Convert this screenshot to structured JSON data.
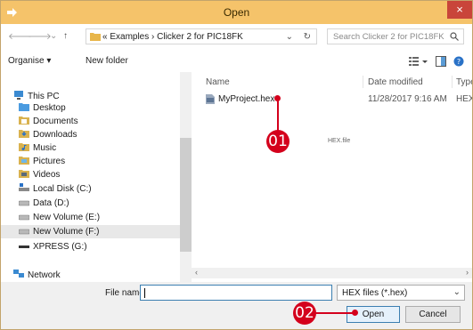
{
  "window": {
    "title": "Open",
    "close_glyph": "×"
  },
  "nav": {
    "back": "🡐",
    "forward": "🡒",
    "dropdown": "⌄",
    "up": "↑"
  },
  "address": {
    "crumbs": "«  Examples  ›  Clicker 2 for PIC18FK",
    "chevron": "⌄",
    "refresh": "↻"
  },
  "search": {
    "placeholder": "Search Clicker 2 for PIC18FK"
  },
  "toolbar": {
    "organise": "Organise ▾",
    "new_folder": "New folder"
  },
  "sidebar": {
    "items": [
      {
        "label": "This PC",
        "icon": "pc-icon"
      },
      {
        "label": "Desktop",
        "icon": "desktop-icon"
      },
      {
        "label": "Documents",
        "icon": "documents-icon"
      },
      {
        "label": "Downloads",
        "icon": "downloads-icon"
      },
      {
        "label": "Music",
        "icon": "music-icon"
      },
      {
        "label": "Pictures",
        "icon": "pictures-icon"
      },
      {
        "label": "Videos",
        "icon": "videos-icon"
      },
      {
        "label": "Local Disk (C:)",
        "icon": "drive-icon"
      },
      {
        "label": "Data (D:)",
        "icon": "drive-icon"
      },
      {
        "label": "New Volume (E:)",
        "icon": "drive-icon"
      },
      {
        "label": "New Volume (F:)",
        "icon": "drive-icon"
      },
      {
        "label": "XPRESS (G:)",
        "icon": "usb-drive-icon"
      },
      {
        "label": "Network",
        "icon": "network-icon"
      }
    ]
  },
  "files": {
    "columns": {
      "name": "Name",
      "date": "Date modified",
      "type": "Type"
    },
    "rows": [
      {
        "name": "MyProject.hex",
        "date": "11/28/2017 9:16 AM",
        "type": "HEX"
      }
    ],
    "hover_label": "HEX.file"
  },
  "bottom": {
    "file_name_label": "File name:",
    "file_name_value": "",
    "filter": "HEX files (*.hex)",
    "open": "Open",
    "cancel": "Cancel"
  },
  "callouts": {
    "one": "01",
    "two": "02"
  },
  "colors": {
    "titlebar": "#f5c36a",
    "accent_red": "#d4001c",
    "close": "#c9453a"
  }
}
